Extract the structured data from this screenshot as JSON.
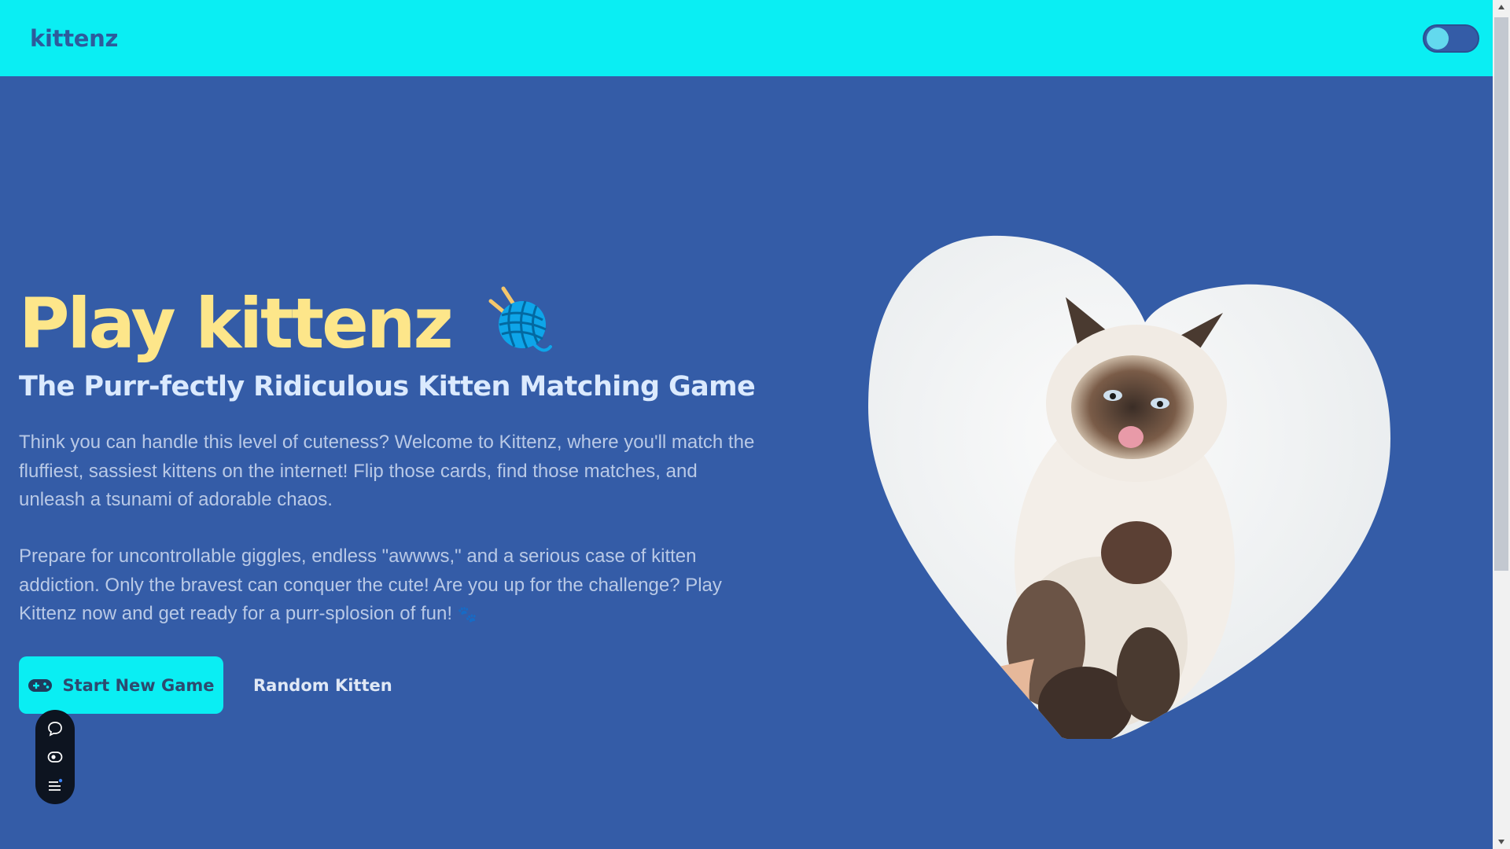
{
  "header": {
    "brand": "kittenz"
  },
  "hero": {
    "title": "Play kittenz",
    "subtitle": "The Purr-fectly Ridiculous Kitten Matching Game",
    "paragraph1": "Think you can handle this level of cuteness? Welcome to Kittenz, where you'll match the fluffiest, sassiest kittens on the internet! Flip those cards, find those matches, and unleash a tsunami of adorable chaos.",
    "paragraph2": "Prepare for uncontrollable giggles, endless \"awwws,\" and a serious case of kitten addiction. Only the bravest can conquer the cute! Are you up for the challenge? Play Kittenz now and get ready for a purr-splosion of fun!",
    "paw_glyph": "🐾"
  },
  "actions": {
    "start_label": "Start New Game",
    "random_label": "Random Kitten"
  },
  "icons": {
    "yarn": "yarn-ball-icon",
    "gamepad": "gamepad-icon",
    "chat": "chat-bubble-icon",
    "eye": "eye-icon",
    "menu": "menu-icon"
  },
  "colors": {
    "background": "#345ca7",
    "header": "#0aeef3",
    "title": "#fde68a",
    "subtitle": "#dbeafe",
    "body_text": "#b9c9e6",
    "button": "#0aeef3"
  }
}
